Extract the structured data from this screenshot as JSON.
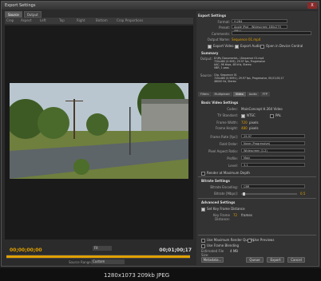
{
  "window": {
    "title": "Export Settings",
    "close": "X"
  },
  "tabs": [
    "Source",
    "Output"
  ],
  "source_toolbar": [
    "Crop",
    "Aspect",
    "Left",
    "Top",
    "Right",
    "Bottom",
    "Crop Proportions"
  ],
  "timeline": {
    "start": "00;00;00;00",
    "end": "00;01;00;17",
    "fit": "Fit",
    "source_range_label": "Source Range:",
    "source_range": "Custom"
  },
  "settings": {
    "export_settings": "Export Settings",
    "format_label": "Format:",
    "format": "H.264",
    "preset_label": "Preset:",
    "preset": "Apple iPod - Widescreen 480x270 (PAL)",
    "comments_label": "Comments:",
    "output_name_label": "Output Name:",
    "output_name": "Sequence 01.mp4",
    "export_video": "Export Video",
    "export_audio": "Export Audio",
    "open_device_central": "Open in Device Central",
    "summary": "Summary",
    "output_label": "Output:",
    "output_text": "D:\\My Documents\\...\\Sequence 01.mp4\n720x480 (0.909), 29.97 fps, Progressive\nAAC, 96 kbps, 48 kHz, Stereo\nVBR, 1 pass",
    "source_label": "Source:",
    "source_text": "Clip, Sequence 01\n720x480 (0.9091), 29.97 fps, Progressive, 00;01;00;17\n48000 Hz, Stereo"
  },
  "sub_tabs": [
    "Filters",
    "Multiplexer",
    "Video",
    "Audio",
    "FTP"
  ],
  "video": {
    "basic_video_settings": "Basic Video Settings",
    "codec_label": "Codec:",
    "codec": "MainConcept H.264 Video",
    "tv_standard_label": "TV Standard:",
    "ntsc": "NTSC",
    "pal": "PAL",
    "frame_width_label": "Frame Width:",
    "frame_width": "720",
    "frame_height_label": "Frame Height:",
    "frame_height": "480",
    "pixels": "pixels",
    "frame_rate_label": "Frame Rate [fps]:",
    "frame_rate": "29.97",
    "field_order_label": "Field Order:",
    "field_order": "None (Progressive)",
    "pixel_aspect_label": "Pixel Aspect Ratio:",
    "pixel_aspect": "Widescreen (1.2)",
    "profile_label": "Profile:",
    "profile": "Main",
    "level_label": "Level:",
    "level": "3.1",
    "render_max_depth": "Render at Maximum Depth",
    "bitrate_settings": "Bitrate Settings",
    "bitrate_encoding_label": "Bitrate Encoding:",
    "bitrate_encoding": "CBR",
    "bitrate_label": "Bitrate [Mbps]:",
    "bitrate": "0.5",
    "advanced_settings": "Advanced Settings",
    "set_key_frame": "Set Key Frame Distance",
    "key_frame_label": "Key Frame Distance:",
    "key_frame": "72",
    "frames": "frames"
  },
  "bottom": {
    "max_render_quality": "Use Maximum Render Quality",
    "use_previews": "Use Previews",
    "frame_blending": "Use Frame Blending",
    "file_size_label": "Estimated File Size:",
    "file_size": "4 MB",
    "metadata": "Metadata...",
    "queue": "Queue",
    "export": "Export",
    "cancel": "Cancel"
  },
  "taskbar": "1280x1073 209kb JPEG"
}
